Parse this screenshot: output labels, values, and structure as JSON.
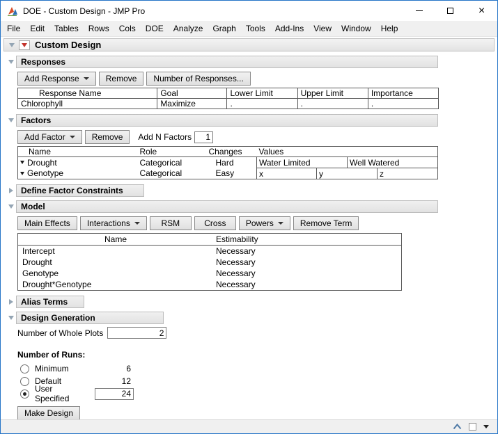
{
  "window": {
    "title": "DOE - Custom Design - JMP Pro",
    "controls": {
      "close": "×"
    }
  },
  "menu": {
    "items": [
      "File",
      "Edit",
      "Tables",
      "Rows",
      "Cols",
      "DOE",
      "Analyze",
      "Graph",
      "Tools",
      "Add-Ins",
      "View",
      "Window",
      "Help"
    ]
  },
  "root": {
    "title": "Custom Design"
  },
  "responses": {
    "title": "Responses",
    "add_button": "Add Response",
    "remove_button": "Remove",
    "number_button": "Number of Responses...",
    "headers": [
      "Response Name",
      "Goal",
      "Lower Limit",
      "Upper Limit",
      "Importance"
    ],
    "rows": [
      {
        "name": "Chlorophyll",
        "goal": "Maximize",
        "lower": ".",
        "upper": ".",
        "importance": "."
      }
    ]
  },
  "factors": {
    "title": "Factors",
    "add_button": "Add Factor",
    "remove_button": "Remove",
    "add_n_label": "Add N Factors",
    "add_n_value": "1",
    "headers": [
      "Name",
      "Role",
      "Changes",
      "Values"
    ],
    "rows": [
      {
        "name": "Drought",
        "role": "Categorical",
        "changes": "Hard",
        "values": [
          "Water Limited",
          "Well Watered"
        ]
      },
      {
        "name": "Genotype",
        "role": "Categorical",
        "changes": "Easy",
        "values": [
          "x",
          "y",
          "z"
        ]
      }
    ]
  },
  "constraints": {
    "title": "Define Factor Constraints"
  },
  "model": {
    "title": "Model",
    "buttons": [
      "Main Effects",
      "Interactions",
      "RSM",
      "Cross",
      "Powers",
      "Remove Term"
    ],
    "headers": [
      "Name",
      "Estimability"
    ],
    "rows": [
      [
        "Intercept",
        "Necessary"
      ],
      [
        "Drought",
        "Necessary"
      ],
      [
        "Genotype",
        "Necessary"
      ],
      [
        "Drought*Genotype",
        "Necessary"
      ]
    ]
  },
  "alias": {
    "title": "Alias Terms"
  },
  "design": {
    "title": "Design Generation",
    "whole_plots_label": "Number of Whole Plots",
    "whole_plots_value": "2",
    "runs_label": "Number of Runs:",
    "options": [
      {
        "label": "Minimum",
        "value": "6",
        "selected": false
      },
      {
        "label": "Default",
        "value": "12",
        "selected": false
      },
      {
        "label": "User Specified",
        "value": "24",
        "selected": true
      }
    ],
    "make_button": "Make Design"
  }
}
